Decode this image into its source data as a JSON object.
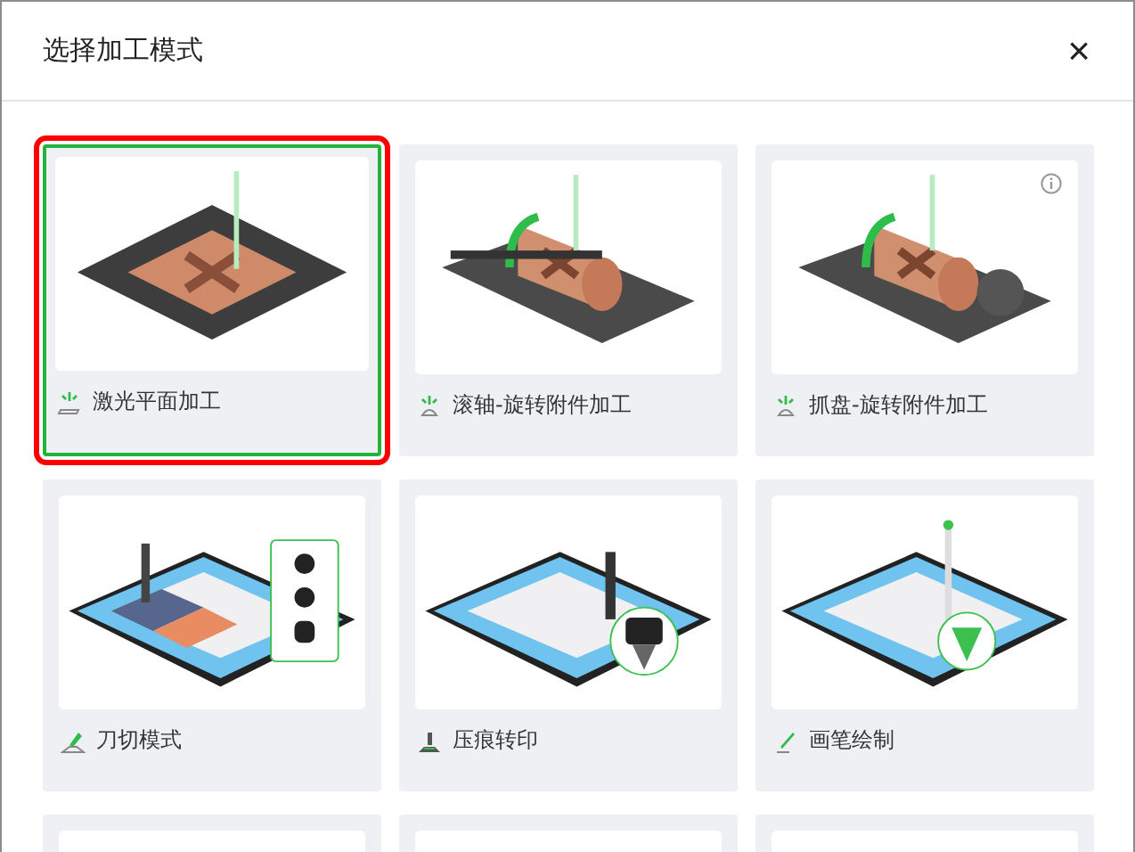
{
  "dialog": {
    "title": "选择加工模式",
    "close": "×"
  },
  "modes": [
    {
      "label": "激光平面加工",
      "kind": "laser",
      "selected": true,
      "info": false
    },
    {
      "label": "滚轴-旋转附件加工",
      "kind": "roller",
      "selected": false,
      "info": false
    },
    {
      "label": "抓盘-旋转附件加工",
      "kind": "chuck",
      "selected": false,
      "info": true
    },
    {
      "label": "刀切模式",
      "kind": "blade",
      "selected": false,
      "info": false
    },
    {
      "label": "压痕转印",
      "kind": "emboss",
      "selected": false,
      "info": false
    },
    {
      "label": "画笔绘制",
      "kind": "pen",
      "selected": false,
      "info": false
    },
    {
      "kind": "partial",
      "selected": false,
      "info": false
    },
    {
      "kind": "partial",
      "selected": false,
      "info": false
    },
    {
      "kind": "partial",
      "selected": false,
      "info": false
    }
  ]
}
